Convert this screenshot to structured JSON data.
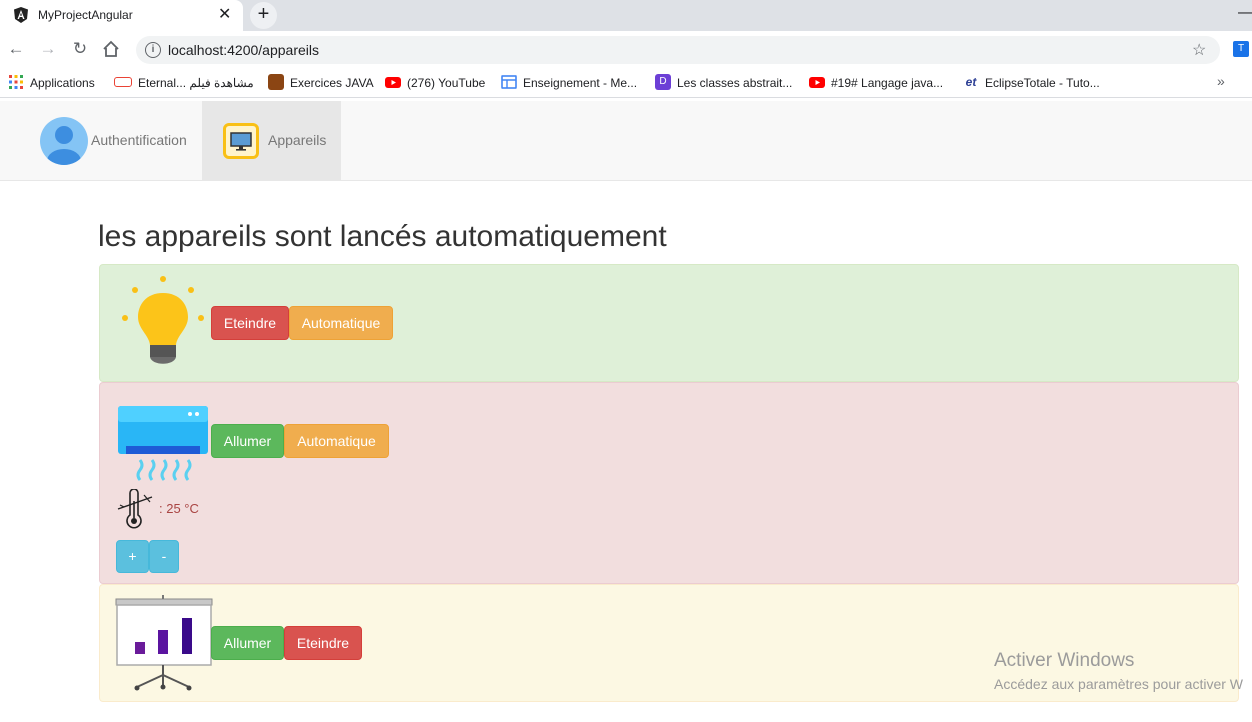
{
  "browser": {
    "tab_title": "MyProjectAngular",
    "tab_close": "✕",
    "new_tab": "+",
    "minimize": "—",
    "url": "localhost:4200/appareils",
    "bookmarks": [
      {
        "label": "Applications",
        "icon": "apps-grid-icon",
        "color": "#e8453c"
      },
      {
        "label": "Eternal... مشاهدة فيلم",
        "icon": "site-favicon",
        "color": "#ea4335"
      },
      {
        "label": "Exercices JAVA",
        "icon": "books-icon",
        "color": "#8b4513"
      },
      {
        "label": "(276) YouTube",
        "icon": "youtube-icon",
        "color": "#ff0000"
      },
      {
        "label": "Enseignement - Me...",
        "icon": "document-icon",
        "color": "#4285f4"
      },
      {
        "label": "Les classes abstrait...",
        "icon": "bookmark-d-icon",
        "color": "#6c3fd6"
      },
      {
        "label": "#19# Langage java...",
        "icon": "youtube-icon",
        "color": "#ff0000"
      },
      {
        "label": "EclipseTotale - Tuto...",
        "icon": "et-icon",
        "color": "#2c3e94"
      }
    ],
    "bookmarks_more": "»"
  },
  "nav": {
    "auth_label": "Authentification",
    "devices_label": "Appareils"
  },
  "main": {
    "title": "les appareils sont lancés automatiquement",
    "devices": [
      {
        "name": "lamp",
        "status": "on",
        "buttons": [
          "Eteindre",
          "Automatique"
        ],
        "color": "#dff0d8"
      },
      {
        "name": "air-conditioner",
        "status": "off",
        "buttons": [
          "Allumer",
          "Automatique"
        ],
        "temperature": ": 25 °C",
        "increment": "+",
        "decrement": "-",
        "color": "#f2dede"
      },
      {
        "name": "projector",
        "status": "standby",
        "buttons": [
          "Allumer",
          "Eteindre"
        ],
        "color": "#fcf8e3"
      }
    ]
  },
  "watermark": {
    "title": "Activer Windows",
    "subtitle": "Accédez aux paramètres pour activer W"
  }
}
